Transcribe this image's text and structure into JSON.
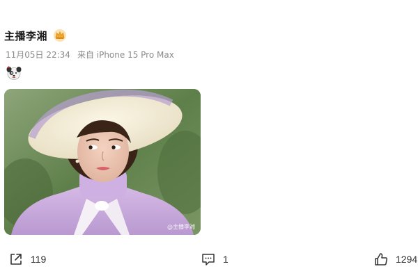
{
  "post": {
    "author": "主播李湘",
    "date": "11月05日 22:34",
    "source": "来自 iPhone 15 Pro Max",
    "image_watermark": "@主播李湘"
  },
  "icons": {
    "badge": "crown-badge-icon",
    "sticker": "dog-emoji-icon",
    "share": "share-icon",
    "comment": "comment-icon",
    "like": "thumbs-up-icon"
  },
  "actions": {
    "share_count": "119",
    "comment_count": "1",
    "like_count": "1294"
  },
  "colors": {
    "badge": "#f0a830",
    "meta_text": "#8a8a8a",
    "icon_stroke": "#333333"
  }
}
